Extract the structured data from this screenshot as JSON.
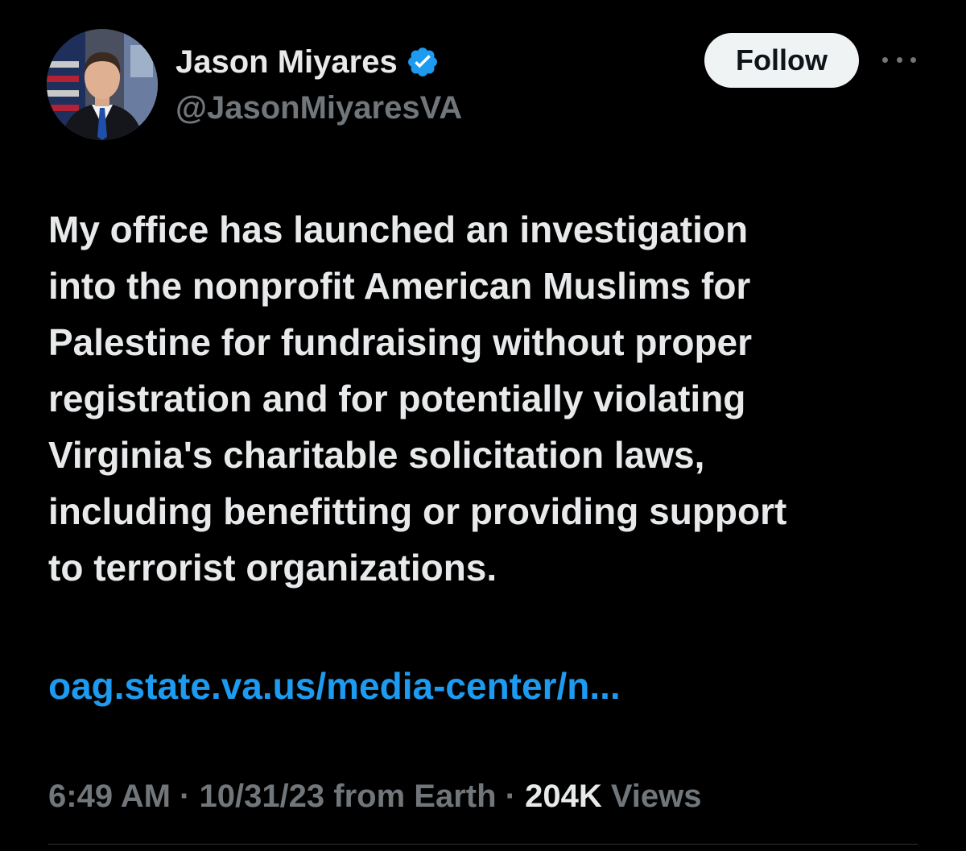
{
  "author": {
    "display_name": "Jason Miyares",
    "handle": "@JasonMiyaresVA",
    "verified": true,
    "badge_color": "#1d9bf0"
  },
  "actions": {
    "follow_label": "Follow"
  },
  "tweet": {
    "lines": [
      "My office has launched an investigation",
      "into the nonprofit American Muslims for",
      "Palestine for fundraising without proper",
      "registration and for potentially violating",
      "Virginia's charitable solicitation laws,",
      "including benefitting or providing support",
      "to terrorist organizations."
    ],
    "link_text": "oag.state.va.us/media-center/n..."
  },
  "meta": {
    "time": "6:49 AM",
    "separator": "·",
    "date_source": "10/31/23 from Earth",
    "view_count": "204K",
    "views_label": "Views"
  },
  "colors": {
    "background": "#000000",
    "primary_text": "#e7e9ea",
    "secondary_text": "#71767b",
    "link": "#1d9bf0"
  }
}
